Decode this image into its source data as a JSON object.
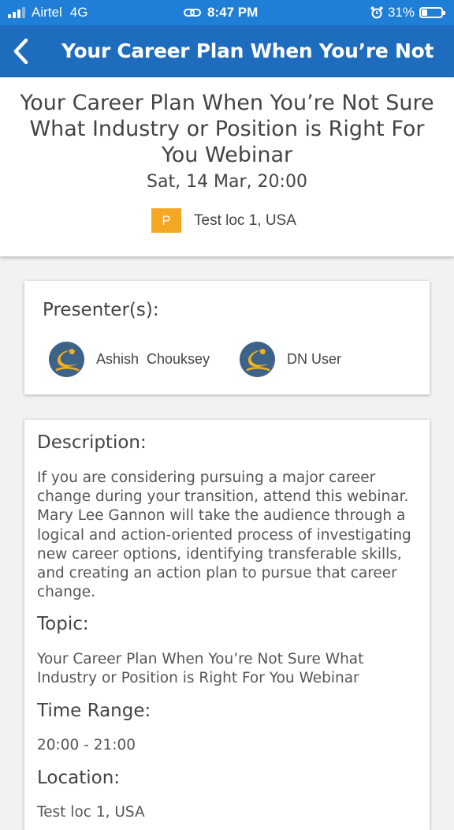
{
  "status_bar": {
    "carrier": "Airtel",
    "network": "4G",
    "time": "8:47 PM",
    "battery": "31%",
    "battery_level": 0.31
  },
  "nav": {
    "title": "Your Career Plan When You’re Not Su...",
    "back_icon": "chevron-left-icon"
  },
  "event": {
    "title": "Your Career Plan When You’re Not Sure What Industry or Position is Right For You Webinar",
    "date": "Sat, 14 Mar, 20:00",
    "location_badge": "P",
    "location": "Test loc 1, USA",
    "badge_color": "#f5a623"
  },
  "presenters": {
    "heading": "Presenter(s):",
    "list": [
      {
        "name": "Ashish  Chouksey"
      },
      {
        "name": "DN User"
      }
    ]
  },
  "details": {
    "description_heading": "Description:",
    "description": "If you are considering pursuing a major career change during your transition, attend this webinar. Mary Lee Gannon will take the audience through a logical and action-oriented process of investigating new career options, identifying transferable skills, and creating an action plan to pursue that career change.",
    "topic_heading": "Topic:",
    "topic": "Your Career Plan When You’re Not Sure What Industry or Position is Right For You Webinar",
    "time_heading": "Time Range:",
    "time_range": "20:00 - 21:00",
    "location_heading": "Location:",
    "location": "Test loc 1, USA"
  },
  "colors": {
    "status_bar": "#1f7ed6",
    "nav_bar": "#1d6cbd",
    "avatar_bg": "#3d6389",
    "avatar_accent": "#f5b21b"
  }
}
